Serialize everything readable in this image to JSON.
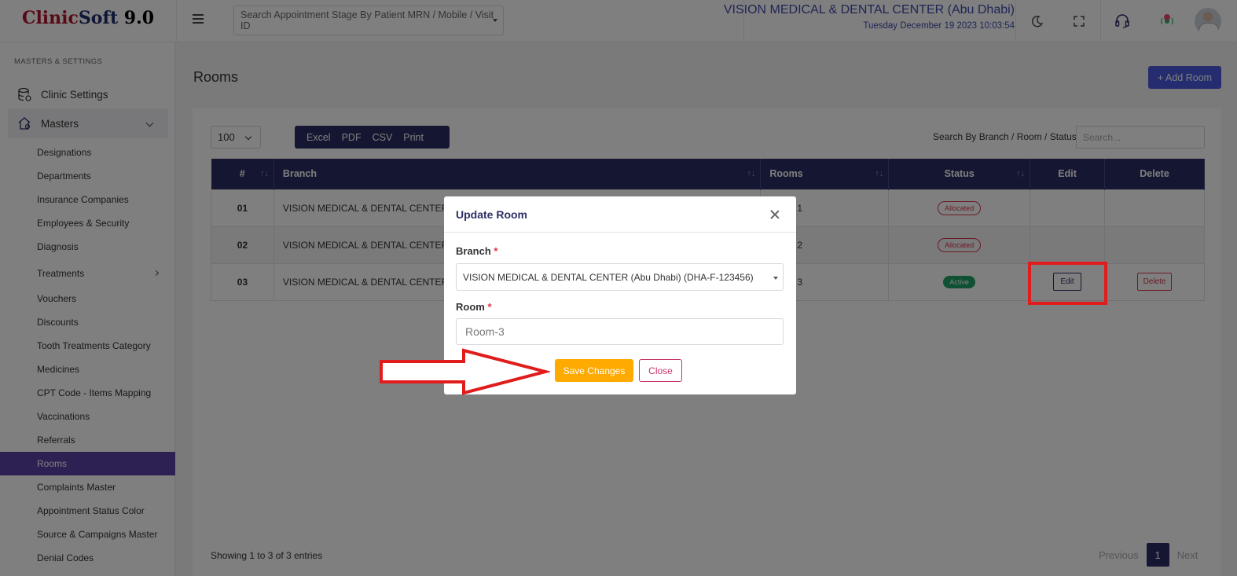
{
  "header": {
    "logo_clinic": "Clinic",
    "logo_soft": "Soft",
    "logo_version": " 9.0",
    "search_placeholder": "Search Appointment Stage By Patient MRN / Mobile / Visit ID",
    "clinic_name": "VISION MEDICAL & DENTAL CENTER (Abu Dhabi)",
    "datetime": "Tuesday December 19 2023 10:03:54",
    "icons": [
      "menu-icon",
      "moon-icon",
      "fullscreen-icon",
      "headset-icon",
      "broadcast-icon",
      "avatar"
    ]
  },
  "sidebar": {
    "heading": "MASTERS & SETTINGS",
    "clinic_settings": "Clinic Settings",
    "masters": "Masters",
    "items": [
      "Designations",
      "Departments",
      "Insurance Companies",
      "Employees & Security",
      "Diagnosis",
      "Treatments",
      "Vouchers",
      "Discounts",
      "Tooth Treatments Category",
      "Medicines",
      "CPT Code - Items Mapping",
      "Vaccinations",
      "Referrals",
      "Rooms",
      "Complaints Master",
      "Appointment Status Color",
      "Source & Campaigns Master",
      "Denial Codes"
    ],
    "active_item": "Rooms"
  },
  "page": {
    "title": "Rooms",
    "add_button": "+ Add Room",
    "page_length": "100",
    "export_buttons": [
      "Excel",
      "PDF",
      "CSV",
      "Print"
    ],
    "search_label": "Search By Branch / Room / Status",
    "search_placeholder": "Search...",
    "columns": [
      "#",
      "Branch",
      "Rooms",
      "Status",
      "Edit",
      "Delete"
    ],
    "rows": [
      {
        "num": "01",
        "branch": "VISION MEDICAL & DENTAL CENTER (",
        "room": "1",
        "status": "Allocated",
        "edit": "",
        "delete": ""
      },
      {
        "num": "02",
        "branch": "VISION MEDICAL & DENTAL CENTER (",
        "room": "2",
        "status": "Allocated",
        "edit": "",
        "delete": ""
      },
      {
        "num": "03",
        "branch": "VISION MEDICAL & DENTAL CENTER (",
        "room": "3",
        "status": "Active",
        "edit": "Edit",
        "delete": "Delete"
      }
    ],
    "showing": "Showing 1 to 3 of 3 entries",
    "pager": {
      "previous": "Previous",
      "current": "1",
      "next": "Next"
    }
  },
  "modal": {
    "title": "Update Room",
    "branch_label": "Branch",
    "branch_value": "VISION MEDICAL & DENTAL CENTER (Abu Dhabi) (DHA-F-123456)",
    "room_label": "Room",
    "room_value": "Room-3",
    "required_mark": "*",
    "save_button": "Save Changes",
    "close_button": "Close"
  },
  "colors": {
    "primary": "#2b2f65",
    "accent": "#4a5be0",
    "sidebar_active": "#5a43a8",
    "save": "#ffaa00",
    "danger": "#d9364a",
    "success": "#1fa365",
    "annotation": "#e11c1c"
  }
}
